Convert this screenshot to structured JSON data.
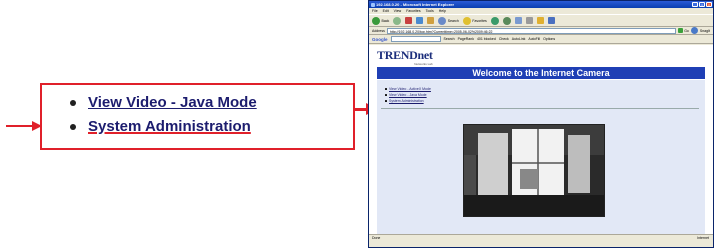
{
  "callout": {
    "items": [
      {
        "label": "View Video - Java Mode"
      },
      {
        "label": "System Administration"
      }
    ]
  },
  "browser": {
    "title": "192.168.0.20 - Microsoft Internet Explorer",
    "menu": [
      "File",
      "Edit",
      "View",
      "Favorites",
      "Tools",
      "Help"
    ],
    "toolbar": {
      "back": "Back",
      "search": "Search",
      "favorites": "Favorites"
    },
    "address_label": "Address",
    "address_value": "http://192.168.0.20/top.htm?Currenttime=2005-06-02%2009:46:22",
    "go_label": "Go",
    "snagit_label": "SnagIt",
    "google": {
      "logo": "Google",
      "items": [
        "Search",
        "PageRank",
        "401 blocked",
        "Check",
        "AutoLink",
        "AutoFill",
        "Options"
      ]
    },
    "status_left": "Done",
    "status_right": "Internet"
  },
  "page": {
    "logo": "TRENDnet",
    "logo_tag": "Networks Lab",
    "banner": "Welcome to the Internet Camera",
    "links": [
      {
        "label": "View Video - ActiveX Mode"
      },
      {
        "label": "View Video - Java Mode"
      },
      {
        "label": "System Administration"
      }
    ]
  },
  "colors": {
    "accent": "#e0202a",
    "banner": "#1f3fb5",
    "panel": "#e2e8f6",
    "link": "#1c1c6e"
  }
}
